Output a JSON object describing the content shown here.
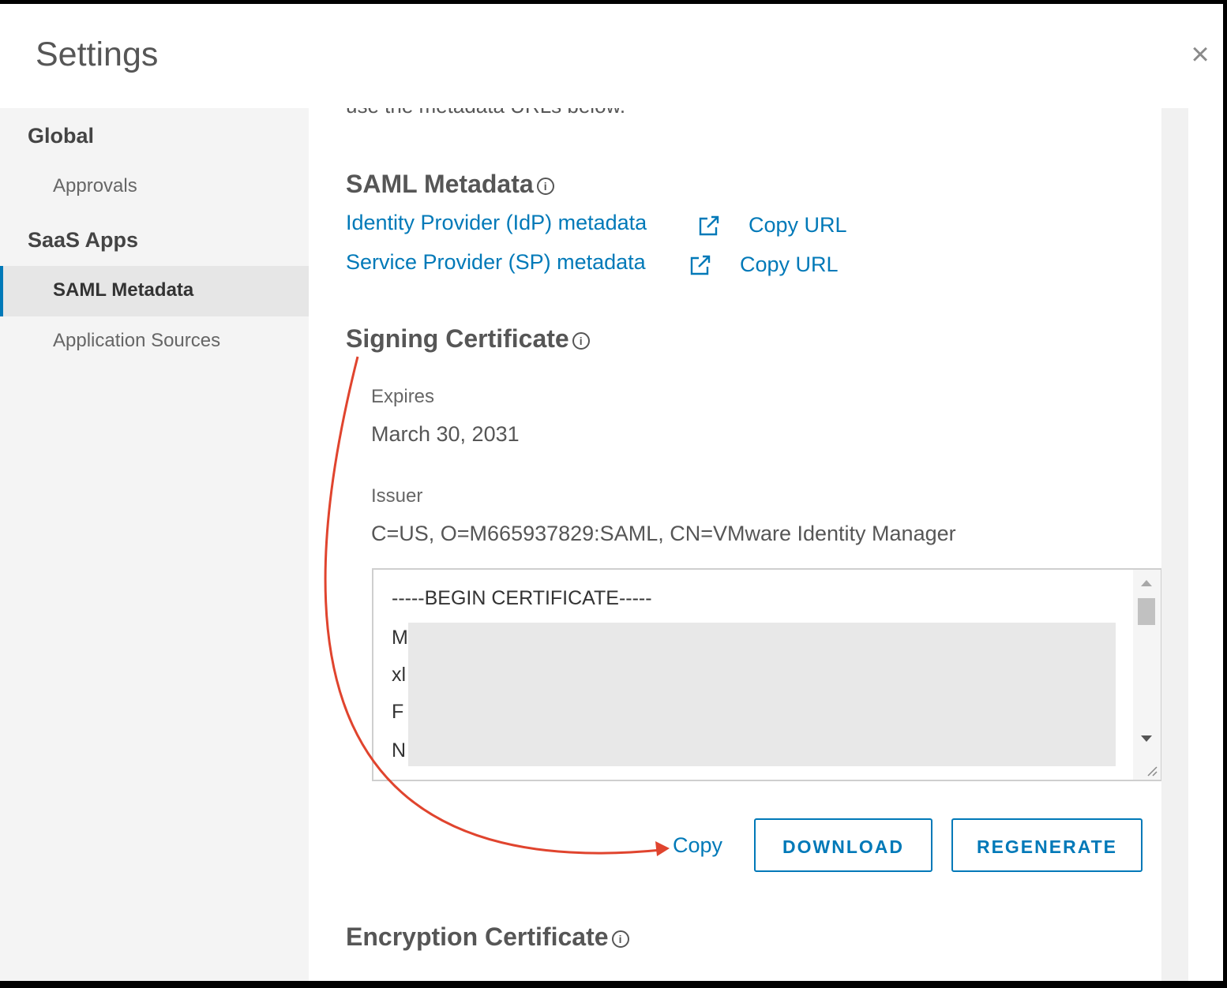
{
  "dialog": {
    "title": "Settings",
    "close_icon": "close-icon"
  },
  "sidebar": {
    "groups": [
      {
        "label": "Global",
        "items": [
          "Approvals"
        ]
      },
      {
        "label": "SaaS Apps",
        "items": [
          "SAML Metadata",
          "Application Sources"
        ]
      }
    ],
    "active_item": "SAML Metadata"
  },
  "content": {
    "clipped_text": "use the metadata URLs below.",
    "saml_metadata": {
      "heading": "SAML Metadata",
      "links": [
        {
          "label": "Identity Provider (IdP) metadata",
          "copy_label": "Copy URL"
        },
        {
          "label": "Service Provider (SP) metadata",
          "copy_label": "Copy URL"
        }
      ]
    },
    "signing_certificate": {
      "heading": "Signing Certificate",
      "expires_label": "Expires",
      "expires_value": "March 30, 2031",
      "issuer_label": "Issuer",
      "issuer_value": "C=US, O=M665937829:SAML, CN=VMware Identity Manager",
      "certificate_lines": [
        "-----BEGIN CERTIFICATE-----",
        "M",
        "xl",
        "F",
        "N"
      ],
      "copy_label": "Copy",
      "download_label": "DOWNLOAD",
      "regenerate_label": "REGENERATE"
    },
    "encryption_certificate": {
      "heading": "Encryption Certificate"
    }
  },
  "annotation": {
    "arrow_color": "#e0442e"
  },
  "colors": {
    "link": "#0079b8",
    "sidebar_bg": "#f4f4f4",
    "active_bg": "#e6e6e6"
  }
}
